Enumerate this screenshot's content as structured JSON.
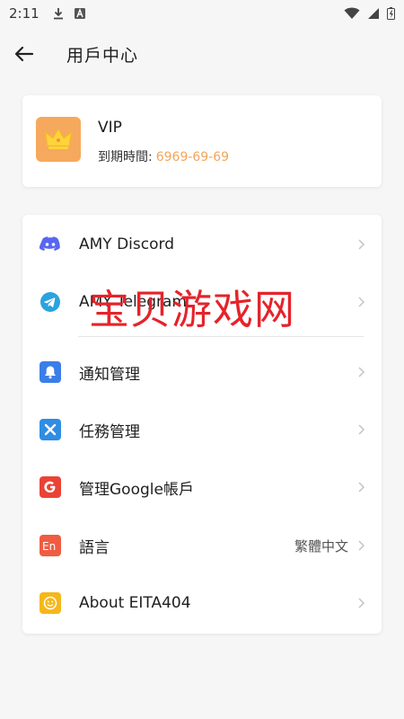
{
  "status_bar": {
    "time": "2:11",
    "left_icons": [
      "download-icon",
      "a-badge-icon"
    ],
    "right_icons": [
      "wifi-icon",
      "signal-icon",
      "battery-icon"
    ]
  },
  "header": {
    "title": "用戶中心",
    "back_icon": "arrow-left-icon"
  },
  "vip_card": {
    "title": "VIP",
    "expiry_label": "到期時間:",
    "expiry_value": "6969-69-69",
    "badge_icon": "crown-icon",
    "badge_color": "#f6a95c",
    "accent_color": "#f2a55a"
  },
  "menu": {
    "items": [
      {
        "label": "AMY Discord",
        "icon": "discord-icon",
        "color": "#5865f2",
        "value": ""
      },
      {
        "label": "AMY Telegram",
        "icon": "telegram-icon",
        "color": "#2aa3df",
        "value": ""
      },
      {
        "label": "通知管理",
        "icon": "bell-icon",
        "color": "#3b7ee8",
        "value": ""
      },
      {
        "label": "任務管理",
        "icon": "tools-icon",
        "color": "#2f8de4",
        "value": ""
      },
      {
        "label": "管理Google帳戶",
        "icon": "google-icon",
        "color": "#ea4335",
        "value": ""
      },
      {
        "label": "語言",
        "icon": "language-icon",
        "color": "#f05c42",
        "value": "繁體中文"
      },
      {
        "label": "About EITA404",
        "icon": "smiley-icon",
        "color": "#f5b71b",
        "value": ""
      }
    ]
  },
  "watermark": {
    "text": "宝贝游戏网",
    "color": "#e5232a"
  }
}
